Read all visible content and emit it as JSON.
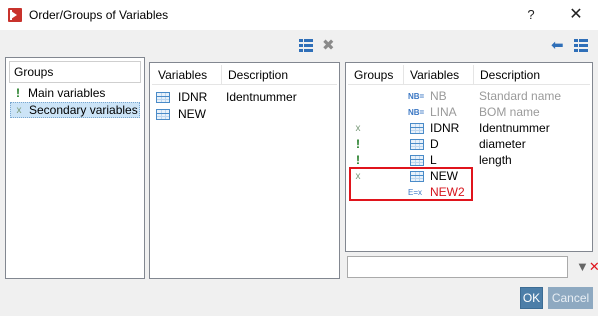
{
  "window": {
    "title": "Order/Groups of Variables",
    "help_label": "?",
    "close_label": "✕"
  },
  "groups_panel": {
    "header": "Groups",
    "items": [
      {
        "label": "Main variables",
        "icon": "exclamation-icon",
        "selected": false
      },
      {
        "label": "Secondary variables",
        "icon": "x-icon",
        "selected": true
      }
    ]
  },
  "variables_panel": {
    "headers": [
      "Variables",
      "Description"
    ],
    "rows": [
      {
        "name": "IDNR",
        "description": "Identnummer",
        "icon": "table-icon"
      },
      {
        "name": "NEW",
        "description": "",
        "icon": "table-icon"
      }
    ]
  },
  "order_panel": {
    "headers": [
      "Groups",
      "Variables",
      "Description"
    ],
    "rows": [
      {
        "group_icon": "",
        "var_icon": "NB=",
        "name": "NB",
        "description": "Standard name",
        "style": "gray"
      },
      {
        "group_icon": "",
        "var_icon": "NB=",
        "name": "LINA",
        "description": "BOM name",
        "style": "gray"
      },
      {
        "group_icon": "x",
        "var_icon": "table",
        "name": "IDNR",
        "description": "Identnummer",
        "style": "normal"
      },
      {
        "group_icon": "!",
        "var_icon": "table",
        "name": "D",
        "description": "diameter",
        "style": "normal"
      },
      {
        "group_icon": "!",
        "var_icon": "table",
        "name": "L",
        "description": "length",
        "style": "normal"
      },
      {
        "group_icon": "x",
        "var_icon": "table",
        "name": "NEW",
        "description": "",
        "style": "normal"
      },
      {
        "group_icon": "",
        "var_icon": "E=x",
        "name": "NEW2",
        "description": "",
        "style": "red"
      }
    ]
  },
  "filter": {
    "value": "",
    "placeholder": ""
  },
  "buttons": {
    "ok": "OK",
    "cancel": "Cancel"
  },
  "colors": {
    "accent": "#2f6fb8",
    "highlight": "#e0141c",
    "selected_row": "#cce4f7"
  }
}
